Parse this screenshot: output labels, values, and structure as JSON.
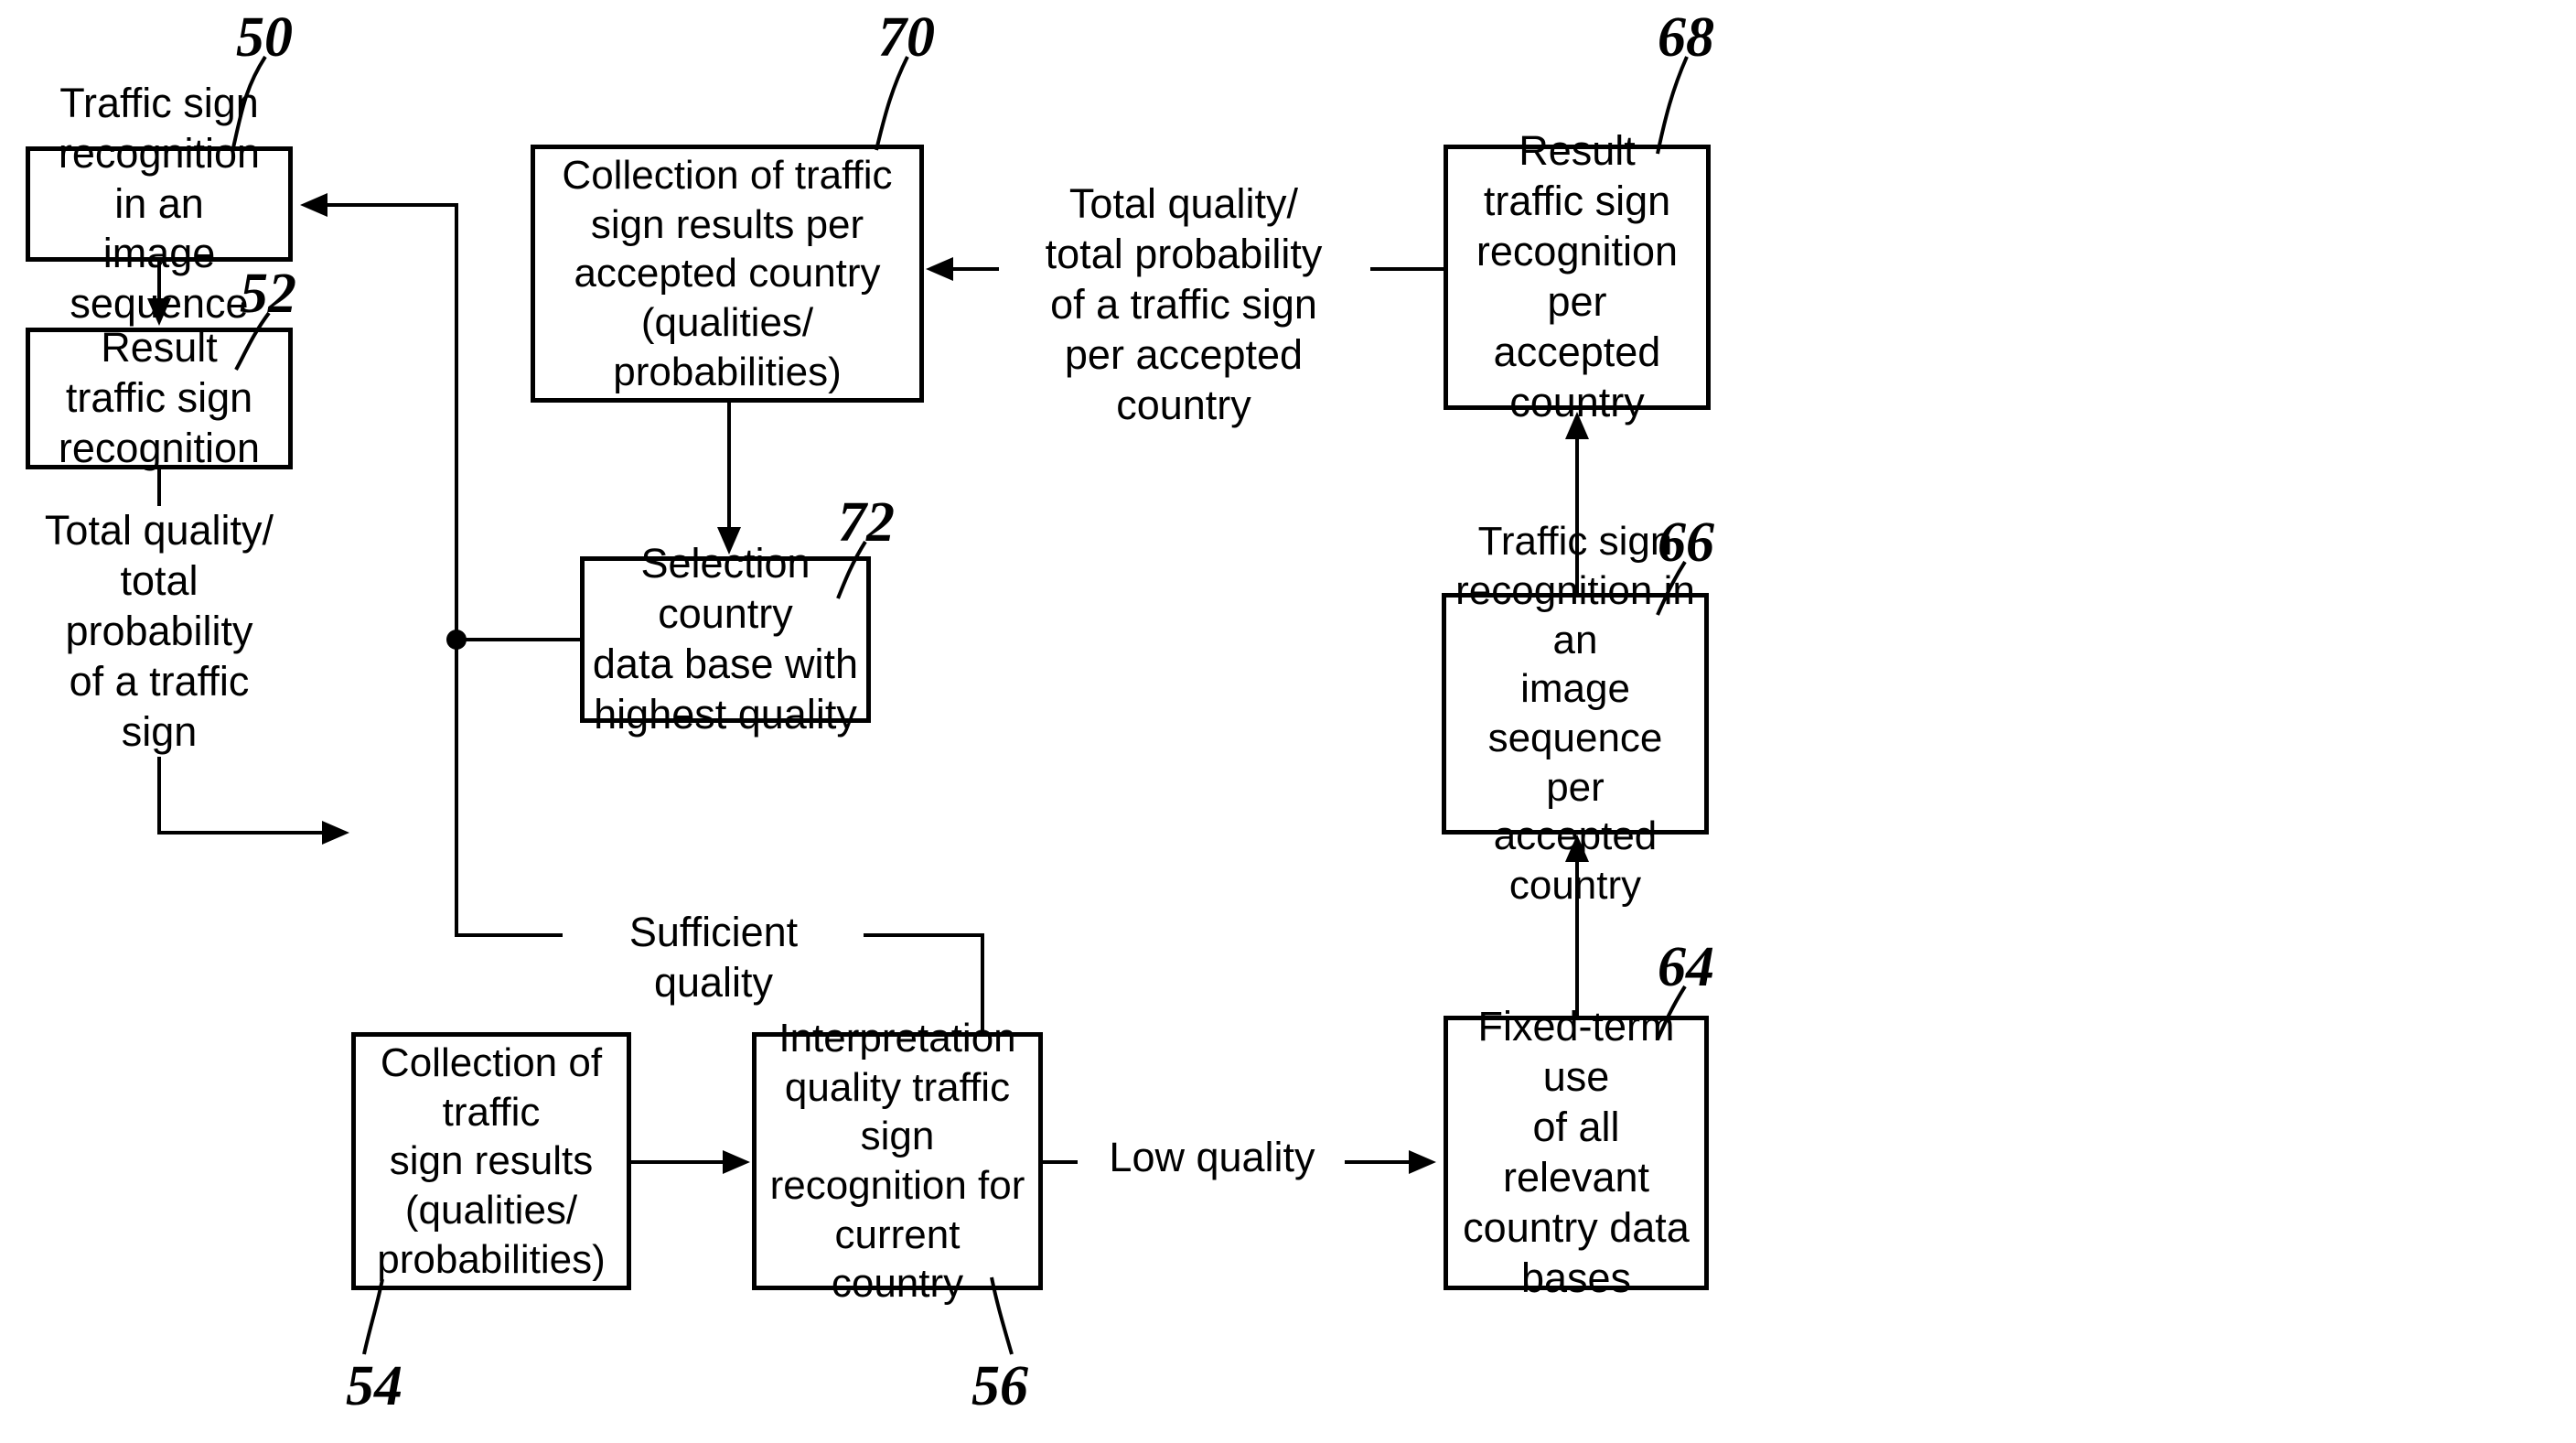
{
  "figure": {
    "type": "patent-flowchart",
    "background_color": "#ffffff",
    "line_color": "#000000"
  },
  "boxes": [
    {
      "ref": "50",
      "text": "Traffic sign\nrecognition in an\nimage sequence",
      "name": "traffic-sign-recognition-image-sequence"
    },
    {
      "ref": "52",
      "text": "Result\ntraffic sign\nrecognition",
      "name": "result-traffic-sign-recognition"
    },
    {
      "ref": "54",
      "text": "Collection of traffic\nsign results\n(qualities/\nprobabilities)",
      "name": "collection-traffic-sign-results"
    },
    {
      "ref": "56",
      "text": "Interpretation\nquality traffic sign\nrecognition for\ncurrent country",
      "name": "interpretation-quality-current-country"
    },
    {
      "ref": "64",
      "text": "Fixed-term use\nof all relevant\ncountry data bases",
      "name": "fixed-term-use-country-data-bases"
    },
    {
      "ref": "66",
      "text": "Traffic sign\nrecognition in an\nimage sequence per\naccepted country",
      "name": "traffic-sign-recognition-per-accepted-country"
    },
    {
      "ref": "68",
      "text": "Result\ntraffic sign\nrecognition per\naccepted country",
      "name": "result-recognition-per-accepted-country"
    },
    {
      "ref": "70",
      "text": "Collection of traffic\nsign results per\naccepted country\n(qualities/ probabilities)",
      "name": "collection-results-per-accepted-country"
    },
    {
      "ref": "72",
      "text": "Selection country\ndata base with\nhighest quality",
      "name": "selection-country-data-base-highest-quality"
    }
  ],
  "edge_labels": [
    {
      "id": "total_quality_left",
      "text": "Total quality/\ntotal probability\nof a traffic sign"
    },
    {
      "id": "total_quality_right",
      "text": "Total quality/\ntotal probability\nof a traffic sign\nper accepted country"
    },
    {
      "id": "sufficient_quality",
      "text": "Sufficient quality"
    },
    {
      "id": "low_quality",
      "text": "Low quality"
    }
  ],
  "reference_numerals": [
    "50",
    "52",
    "54",
    "56",
    "64",
    "66",
    "68",
    "70",
    "72"
  ]
}
